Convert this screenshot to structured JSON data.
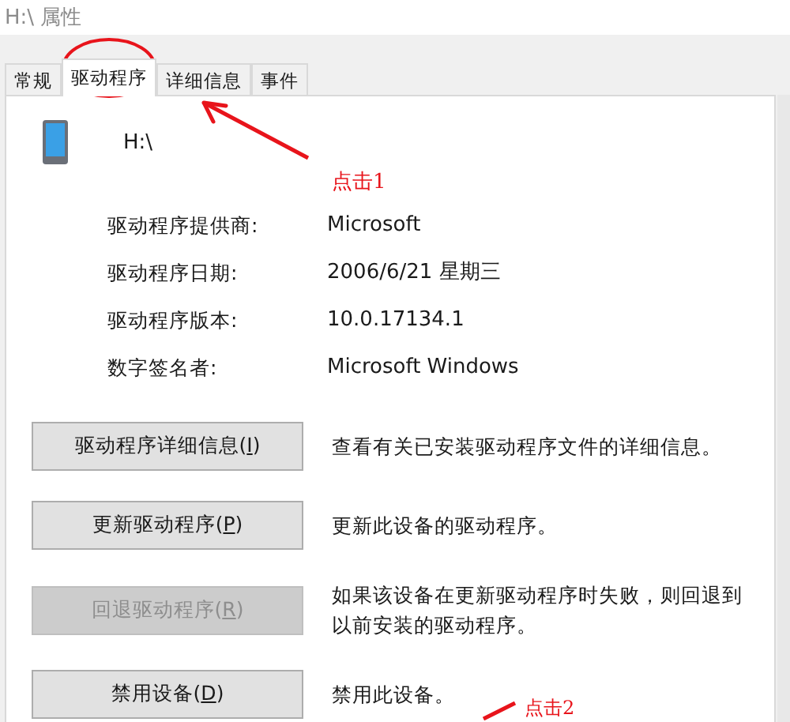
{
  "window": {
    "title": "H:\\ 属性"
  },
  "tabs": [
    {
      "label": "常规",
      "selected": false
    },
    {
      "label": "驱动程序",
      "selected": true
    },
    {
      "label": "详细信息",
      "selected": false
    },
    {
      "label": "事件",
      "selected": false
    }
  ],
  "device": {
    "name": "H:\\"
  },
  "properties": [
    {
      "label": "驱动程序提供商:",
      "value": "Microsoft"
    },
    {
      "label": "驱动程序日期:",
      "value": "2006/6/21 星期三"
    },
    {
      "label": "驱动程序版本:",
      "value": "10.0.17134.1"
    },
    {
      "label": "数字签名者:",
      "value": "Microsoft Windows"
    }
  ],
  "actions": [
    {
      "button": "驱动程序详细信息(I)",
      "disabled": false,
      "description": "查看有关已安装驱动程序文件的详细信息。"
    },
    {
      "button": "更新驱动程序(P)",
      "disabled": false,
      "description": "更新此设备的驱动程序。"
    },
    {
      "button": "回退驱动程序(R)",
      "disabled": true,
      "description": "如果该设备在更新驱动程序时失败，则回退到以前安装的驱动程序。"
    },
    {
      "button": "禁用设备(D)",
      "disabled": false,
      "description": "禁用此设备。"
    }
  ],
  "annotations": [
    {
      "kind": "tab",
      "text": "点击1"
    },
    {
      "kind": "button",
      "text": "点击2"
    }
  ]
}
